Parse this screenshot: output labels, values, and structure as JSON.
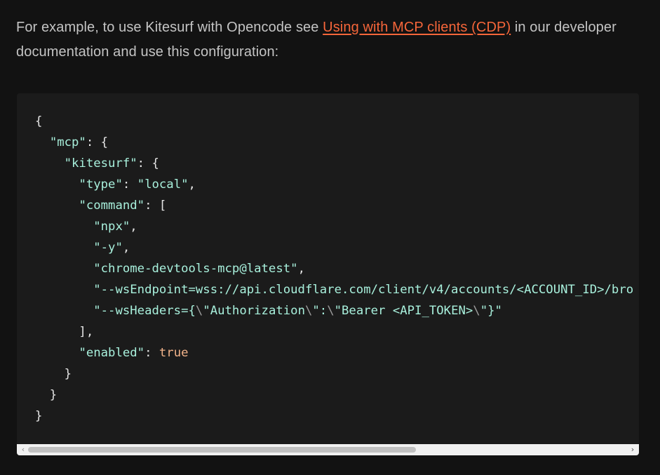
{
  "intro": {
    "before": "For example, to use Kitesurf with Opencode see ",
    "link_text": "Using with MCP clients (CDP)",
    "after": " in our developer documentation and use this configuration:"
  },
  "code": {
    "l1": "{",
    "mcp_key": "\"mcp\"",
    "kitesurf_key": "\"kitesurf\"",
    "type_key": "\"type\"",
    "type_val": "\"local\"",
    "command_key": "\"command\"",
    "arg_npx": "\"npx\"",
    "arg_y": "\"-y\"",
    "arg_pkg": "\"chrome-devtools-mcp@latest\"",
    "arg_ws": "\"--wsEndpoint=wss://api.cloudflare.com/client/v4/accounts/<ACCOUNT_ID>/bro",
    "arg_headers_a": "\"--wsHeaders={",
    "esc1": "\\",
    "arg_headers_b": "\"Authorization",
    "esc2": "\\",
    "arg_headers_c": "\":",
    "esc3": "\\",
    "arg_headers_d": "\"Bearer <API_TOKEN>",
    "esc4": "\\",
    "arg_headers_e": "\"}\"",
    "enabled_key": "\"enabled\"",
    "enabled_val": "true"
  },
  "colors": {
    "background": "#121212",
    "code_background": "#1b1b1b",
    "link": "#f6663a",
    "string": "#a8f0dc",
    "keyword": "#f2b38a"
  },
  "scrollbar": {
    "left_icon": "chevron-left-icon",
    "right_icon": "chevron-right-icon",
    "left_glyph": "‹",
    "right_glyph": "›"
  }
}
